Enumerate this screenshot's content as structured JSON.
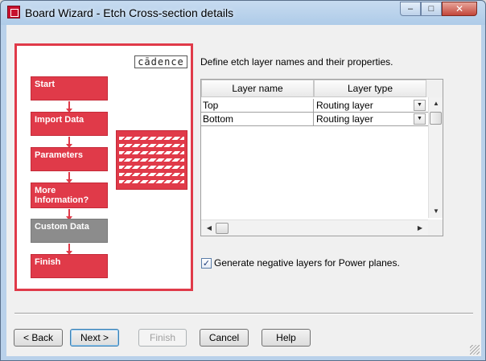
{
  "window": {
    "title": "Board Wizard - Etch Cross-section details",
    "minimize_glyph": "–",
    "maximize_glyph": "□",
    "close_glyph": "✕"
  },
  "flow": {
    "logo_text": "cādence",
    "steps": [
      {
        "label": "Start",
        "state": "done"
      },
      {
        "label": "Import Data",
        "state": "done"
      },
      {
        "label": "Parameters",
        "state": "done"
      },
      {
        "label": "More Information?",
        "state": "done"
      },
      {
        "label": "Custom Data",
        "state": "current"
      },
      {
        "label": "Finish",
        "state": "pending"
      }
    ],
    "colors": {
      "step": "#e03a49",
      "current": "#8c8c8c"
    }
  },
  "main": {
    "instruction": "Define etch layer names and their properties.",
    "grid": {
      "columns": [
        "Layer name",
        "Layer type"
      ],
      "rows": [
        {
          "name": "Top",
          "type": "Routing layer"
        },
        {
          "name": "Bottom",
          "type": "Routing layer"
        }
      ],
      "combo_glyph": "▼",
      "scroll_glyphs": {
        "up": "▲",
        "down": "▼",
        "left": "◀",
        "right": "▶"
      }
    },
    "checkbox": {
      "checked": true,
      "check_glyph": "✓",
      "label": "Generate negative layers for Power planes."
    }
  },
  "buttons": {
    "back": "< Back",
    "next": "Next >",
    "finish": "Finish",
    "cancel": "Cancel",
    "help": "Help"
  }
}
